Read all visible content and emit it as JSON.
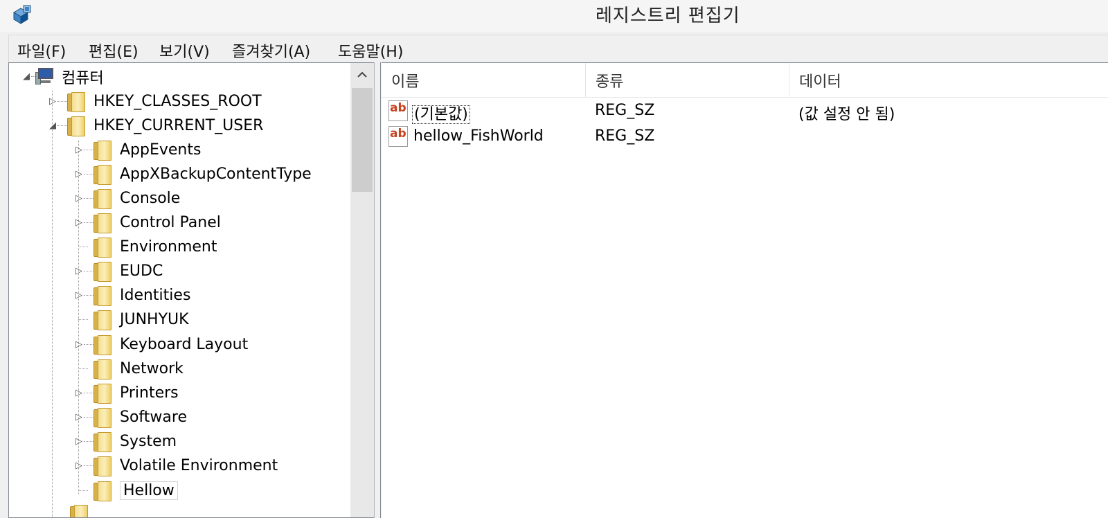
{
  "window": {
    "title": "레지스트리 편집기"
  },
  "menu": [
    "파일(F)",
    "편집(E)",
    "보기(V)",
    "즐겨찾기(A)",
    "도움말(H)"
  ],
  "tree": {
    "root": "컴퓨터",
    "hives": [
      {
        "label": "HKEY_CLASSES_ROOT",
        "expanded": false
      },
      {
        "label": "HKEY_CURRENT_USER",
        "expanded": true
      }
    ],
    "children": [
      {
        "label": "AppEvents",
        "has_children": true
      },
      {
        "label": "AppXBackupContentType",
        "has_children": true
      },
      {
        "label": "Console",
        "has_children": true
      },
      {
        "label": "Control Panel",
        "has_children": true
      },
      {
        "label": "Environment",
        "has_children": false
      },
      {
        "label": "EUDC",
        "has_children": true
      },
      {
        "label": "Identities",
        "has_children": true
      },
      {
        "label": "JUNHYUK",
        "has_children": false
      },
      {
        "label": "Keyboard Layout",
        "has_children": true
      },
      {
        "label": "Network",
        "has_children": false
      },
      {
        "label": "Printers",
        "has_children": true
      },
      {
        "label": "Software",
        "has_children": true
      },
      {
        "label": "System",
        "has_children": true
      },
      {
        "label": "Volatile Environment",
        "has_children": true
      },
      {
        "label": "Hellow",
        "has_children": false,
        "selected": true
      }
    ]
  },
  "list": {
    "columns": [
      "이름",
      "종류",
      "데이터"
    ],
    "rows": [
      {
        "name": "(기본값)",
        "type": "REG_SZ",
        "data": "(값 설정 안 됨)",
        "focused": true
      },
      {
        "name": "hellow_FishWorld",
        "type": "REG_SZ",
        "data": ""
      }
    ],
    "value_icon": "ab"
  },
  "icons": {
    "app": "registry-editor-icon",
    "computer": "computer-icon",
    "folder": "folder-icon",
    "expanded": "triangle-down-icon",
    "collapsed": "triangle-right-icon",
    "scroll_up": "chevron-up-icon",
    "string_value": "string-value-icon"
  },
  "colors": {
    "folder": "#f3dd8f",
    "ab_icon": "#c8421f",
    "pane_border": "#828790"
  }
}
